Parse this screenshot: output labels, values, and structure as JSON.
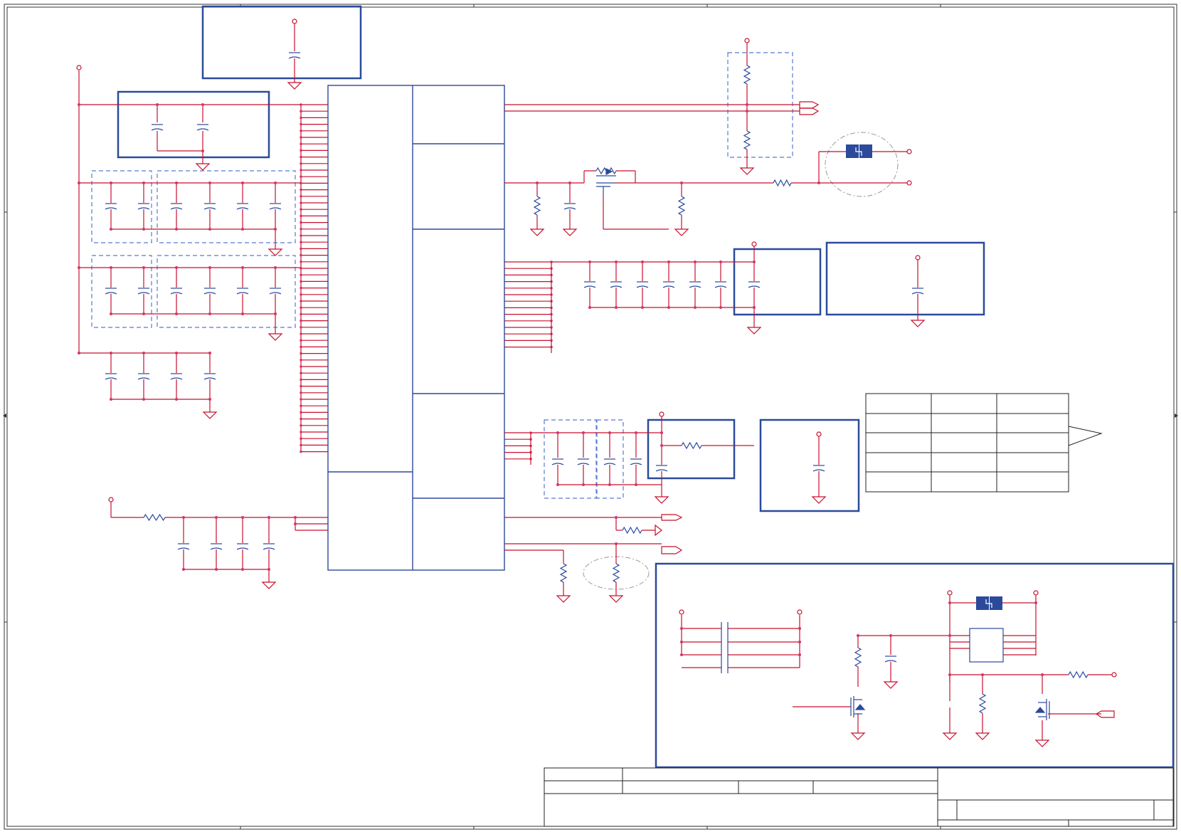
{
  "schematic": {
    "wire_color": "#c8102e",
    "net_color": "#d6336c",
    "box_color": "#2b4a9b",
    "frame_color": "#222222",
    "dashed_color": "#5b7ad1",
    "title_block": {
      "rows_text": []
    }
  }
}
